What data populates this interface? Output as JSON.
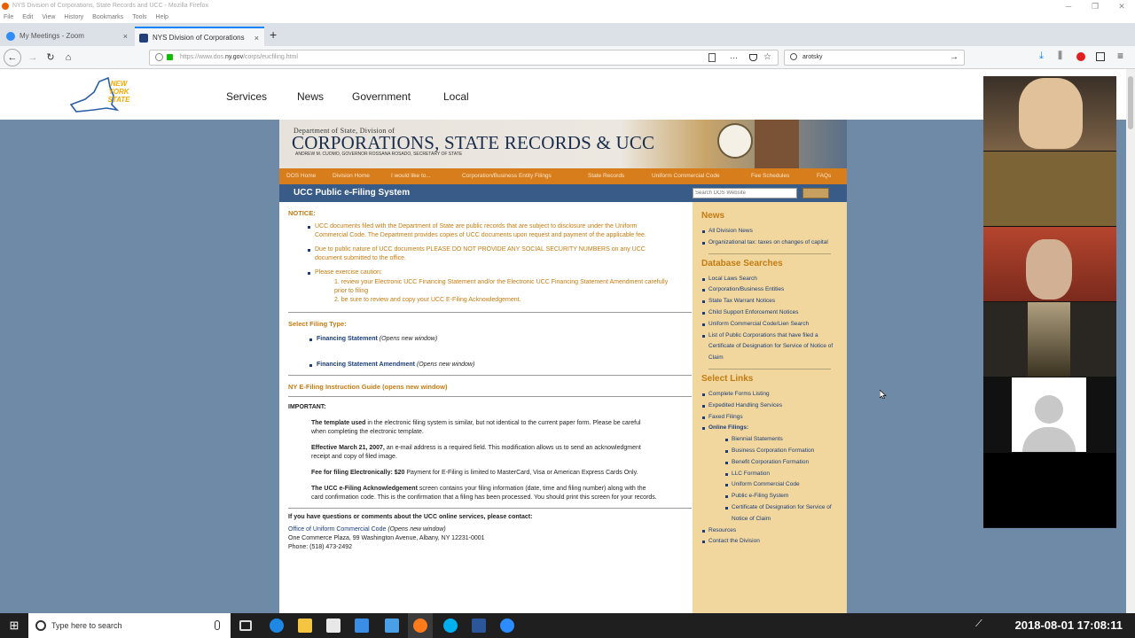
{
  "window": {
    "title": "NYS Division of Corporations, State Records and UCC - Mozilla Firefox"
  },
  "menubar": [
    "File",
    "Edit",
    "View",
    "History",
    "Bookmarks",
    "Tools",
    "Help"
  ],
  "tabs": [
    {
      "label": "My Meetings - Zoom",
      "close": "×"
    },
    {
      "label": "NYS Division of Corporations",
      "close": "×"
    }
  ],
  "new_tab": "+",
  "urlbar": {
    "prefix": "https://www.dos.",
    "domain": "ny.gov",
    "path": "/corps/eucfiling.html",
    "menu": "···"
  },
  "searchbar": {
    "value": "arotsky"
  },
  "ny": {
    "logo_text": "NEW YORK STATE",
    "nav": [
      "Services",
      "News",
      "Government",
      "Local"
    ]
  },
  "banner": {
    "dept": "Department of State, Division of",
    "title": "CORPORATIONS, STATE RECORDS & UCC",
    "sub": "ANDREW M. CUOMO, GOVERNOR     ROSSANA ROSADO, SECRETARY OF STATE"
  },
  "orange_nav": [
    "DOS Home",
    "Division Home",
    "I would like to...",
    "Corporation/Business Entity Filings",
    "State Records",
    "Uniform Commercial Code",
    "Fee Schedules",
    "FAQs"
  ],
  "section_title": "UCC Public e-Filing System",
  "dos_search": {
    "placeholder": "Search DOS Website"
  },
  "main": {
    "notice_h": "NOTICE:",
    "notice": [
      "UCC documents filed with the Department of State are public records that are subject to disclosure under the Uniform Commercial Code. The Department provides copies of UCC documents upon request and payment of the applicable fee.",
      "Due to public nature of UCC documents PLEASE DO NOT PROVIDE ANY SOCIAL SECURITY NUMBERS on any UCC document submitted to the office.",
      "Please exercise caution:"
    ],
    "caution": [
      "1. review your Electronic UCC Financing Statement and/or the Electronic UCC Financing Statement Amendment carefully prior to filing",
      "2. be sure to review and copy your UCC E-Filing Acknowledgement."
    ],
    "select_h": "Select Filing Type:",
    "filing_types": [
      {
        "link": "Financing Statement",
        "note": "(Opens new window)"
      },
      {
        "link": "Financing Statement Amendment",
        "note": "(Opens new window)"
      }
    ],
    "guide": "NY E-Filing Instruction Guide (opens new window)",
    "important_h": "IMPORTANT:",
    "important": [
      {
        "b": "The template used",
        "t": " in the electronic filing system is similar, but not identical to the current paper form. Please be careful when completing the electronic template."
      },
      {
        "b": "Effective March 21, 2007,",
        "t": " an e-mail address is a required field. This modification allows us to send an acknowledgment receipt and copy of filed image."
      },
      {
        "b": "Fee for filing Electronically: $20",
        "t": " Payment for E-Filing is limited to MasterCard, Visa or American Express Cards Only."
      },
      {
        "b": "The UCC e-Filing Acknowledgement",
        "t": " screen contains your filing information (date, time and filing number) along with the card confirmation code. This is the confirmation that a filing has been processed. You should print this screen for your records."
      }
    ],
    "contact_h": "If you have questions or comments about the UCC online services, please contact:",
    "contact_link": "Office of Uniform Commercial Code",
    "contact_note": "(Opens new window)",
    "address": "One Commerce Plaza, 99 Washington Avenue, Albany, NY 12231-0001",
    "phone": "Phone: (518) 473-2492"
  },
  "sidebar": {
    "news_h": "News",
    "news": [
      "All Division News",
      "Organizational tax: taxes on changes of capital"
    ],
    "db_h": "Database Searches",
    "db": [
      "Local Laws Search",
      "Corporation/Business Entities",
      "State Tax Warrant Notices",
      "Child Support Enforcement Notices",
      "Uniform Commercial Code/Lien Search",
      "List of Public Corporations that have filed a Certificate of Designation for Service of Notice of Claim"
    ],
    "links_h": "Select Links",
    "links": [
      "Complete Forms Listing",
      "Expedited Handling Services",
      "Faxed Filings",
      "Online Filings:"
    ],
    "online": [
      "Biennial Statements",
      "Business Corporation Formation",
      "Benefit Corporation Formation",
      "LLC Formation",
      "Uniform Commercial Code",
      "Public e-Filing System",
      "Certificate of Designation for Service of Notice of Claim"
    ],
    "links2": [
      "Resources",
      "Contact the Division"
    ]
  },
  "taskbar": {
    "search_placeholder": "Type here to search",
    "clock": "2018-08-01 17:08:11"
  },
  "colors": {
    "orange": "#d77d1c",
    "navy": "#1a3d7a",
    "blue": "#385b88",
    "sidebar": "#f1d79e",
    "page_bg": "#6f8aa6"
  }
}
